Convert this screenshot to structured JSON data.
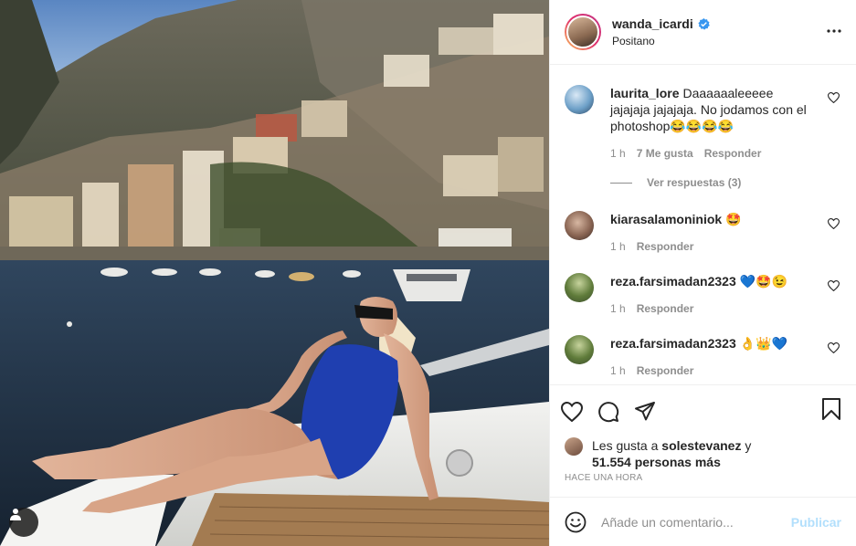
{
  "header": {
    "username": "wanda_icardi",
    "location": "Positano"
  },
  "comments": [
    {
      "username": "laurita_lore",
      "text": "Daaaaaaleeeee jajajaja jajajaja. No jodamos con el photoshop😂😂😂😂",
      "time": "1 h",
      "likes": "7 Me gusta",
      "reply_label": "Responder",
      "view_replies": "Ver respuestas (3)"
    },
    {
      "username": "kiarasalamoniniok",
      "text": "🤩",
      "time": "1 h",
      "reply_label": "Responder"
    },
    {
      "username": "reza.farsimadan2323",
      "text": "💙🤩😉",
      "time": "1 h",
      "reply_label": "Responder"
    },
    {
      "username": "reza.farsimadan2323",
      "text": "👌👑💙",
      "time": "1 h",
      "reply_label": "Responder"
    }
  ],
  "likes": {
    "prefix": "Les gusta a",
    "user": "solestevanez",
    "conj": "y",
    "others": "51.554 personas más"
  },
  "timestamp": "Hace una hora",
  "composer": {
    "placeholder": "Añade un comentario...",
    "post_label": "Publicar"
  },
  "icons": {
    "more": "more-options-icon",
    "like": "heart-icon",
    "comment": "comment-icon",
    "share": "share-icon",
    "save": "bookmark-icon",
    "emoji": "emoji-icon",
    "verified": "verified-badge-icon",
    "user_tag": "user-tag-icon"
  },
  "colors": {
    "verified": "#3897f0",
    "post_disabled": "#b2dffc",
    "meta": "#8e8e8e"
  }
}
